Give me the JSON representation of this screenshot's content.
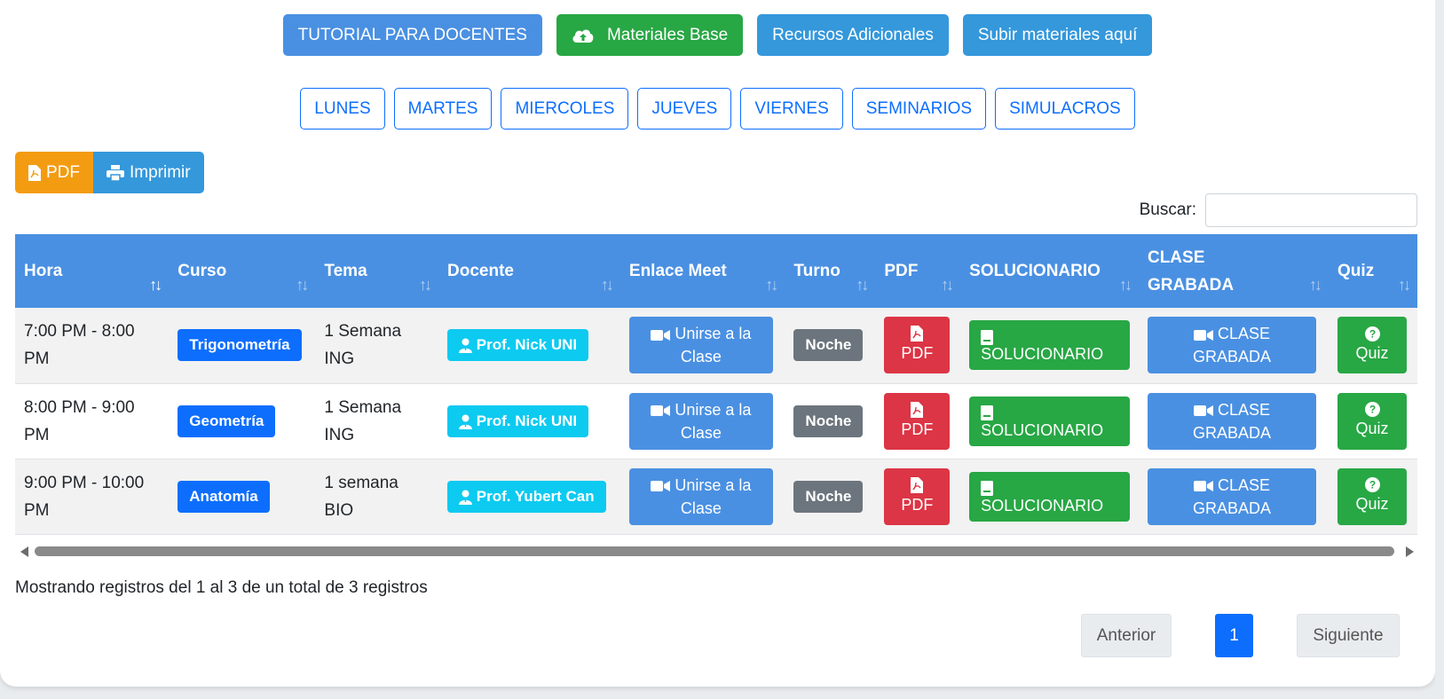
{
  "top_buttons": {
    "tutorial": "TUTORIAL PARA DOCENTES",
    "materiales": "Materiales Base",
    "recursos": "Recursos Adicionales",
    "subir": "Subir materiales aquí"
  },
  "days": [
    "LUNES",
    "MARTES",
    "MIERCOLES",
    "JUEVES",
    "VIERNES",
    "SEMINARIOS",
    "SIMULACROS"
  ],
  "export": {
    "pdf": "PDF",
    "print": "Imprimir"
  },
  "search": {
    "label": "Buscar:",
    "value": ""
  },
  "table": {
    "headers": [
      "Hora",
      "Curso",
      "Tema",
      "Docente",
      "Enlace Meet",
      "Turno",
      "PDF",
      "SOLUCIONARIO",
      "CLASE GRABADA",
      "Quiz"
    ],
    "rows": [
      {
        "hora": "7:00 PM - 8:00 PM",
        "curso": "Trigonometría",
        "tema": "1 Semana ING",
        "docente": "Prof. Nick UNI",
        "meet": "Unirse a la Clase",
        "turno": "Noche",
        "pdf": "PDF",
        "solucionario": "SOLUCIONARIO",
        "grabada": "CLASE GRABADA",
        "quiz": "Quiz"
      },
      {
        "hora": "8:00 PM - 9:00 PM",
        "curso": "Geometría",
        "tema": "1 Semana ING",
        "docente": "Prof. Nick UNI",
        "meet": "Unirse a la Clase",
        "turno": "Noche",
        "pdf": "PDF",
        "solucionario": "SOLUCIONARIO",
        "grabada": "CLASE GRABADA",
        "quiz": "Quiz"
      },
      {
        "hora": "9:00 PM - 10:00 PM",
        "curso": "Anatomía",
        "tema": "1 semana BIO",
        "docente": "Prof. Yubert Can",
        "meet": "Unirse a la Clase",
        "turno": "Noche",
        "pdf": "PDF",
        "solucionario": "SOLUCIONARIO",
        "grabada": "CLASE GRABADA",
        "quiz": "Quiz"
      }
    ]
  },
  "info": "Mostrando registros del 1 al 3 de un total de 3 registros",
  "pagination": {
    "prev": "Anterior",
    "current": "1",
    "next": "Siguiente"
  },
  "colors": {
    "primary_blue": "#4a90e2",
    "green": "#28a745",
    "orange": "#f39c12",
    "red": "#dc3545",
    "cyan": "#0dcaf0",
    "gray": "#6c757d"
  },
  "icons": {
    "materiales": "cloud-upload-icon",
    "pdf": "file-pdf-icon",
    "print": "printer-icon",
    "docente": "user-icon",
    "meet": "video-camera-icon",
    "solucionario": "book-icon",
    "quiz": "question-circle-icon"
  }
}
